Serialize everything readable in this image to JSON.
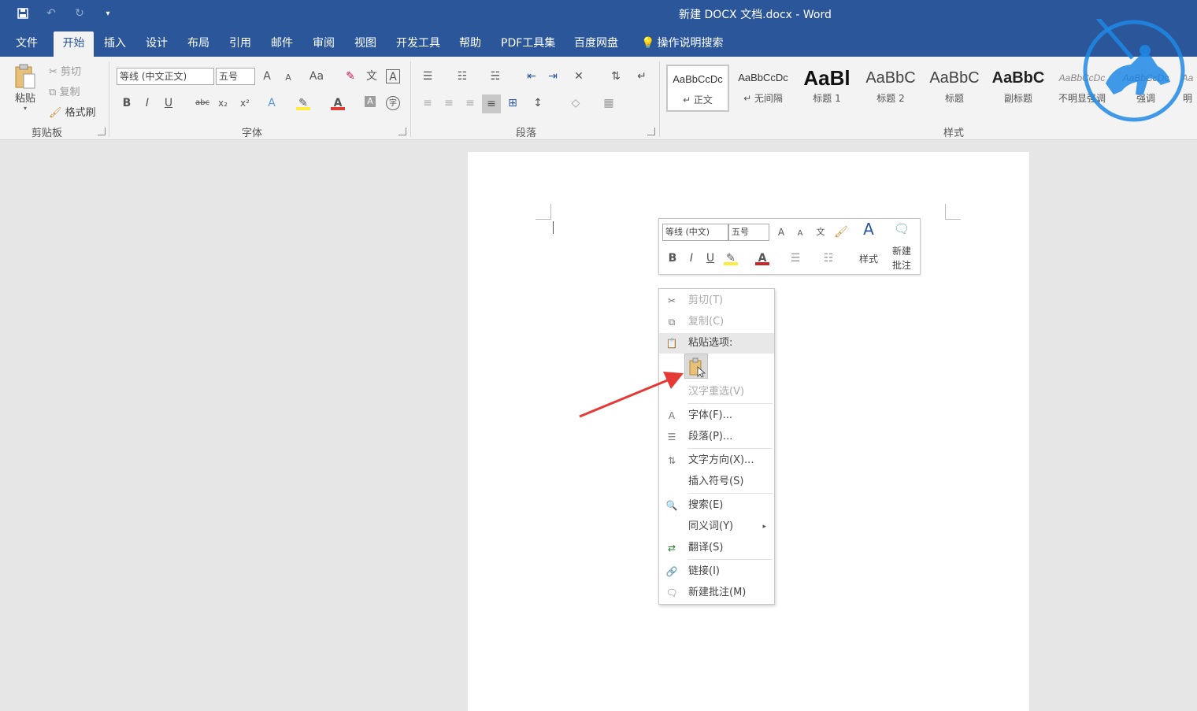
{
  "titlebar": {
    "title": "新建 DOCX 文档.docx - Word",
    "qat": [
      "save-icon",
      "undo-icon",
      "redo-icon",
      "customize-icon"
    ]
  },
  "tabs": [
    "文件",
    "开始",
    "插入",
    "设计",
    "布局",
    "引用",
    "邮件",
    "审阅",
    "视图",
    "开发工具",
    "帮助",
    "PDF工具集",
    "百度网盘",
    "操作说明搜索"
  ],
  "ribbon": {
    "clipboard": {
      "paste": "粘贴",
      "cut": "剪切",
      "copy": "复制",
      "format_painter": "格式刷",
      "label": "剪贴板"
    },
    "font": {
      "font_name": "等线 (中文正文)",
      "font_size": "五号",
      "label": "字体",
      "bold": "B",
      "italic": "I",
      "underline": "U",
      "strike": "abc",
      "sub": "x₂",
      "sup": "x²",
      "grow": "A",
      "shrink": "A",
      "case": "Aa",
      "font_color": "A",
      "char_shade": "A",
      "char_border": "A",
      "phonetic": "文"
    },
    "paragraph": {
      "label": "段落"
    },
    "styles": {
      "label": "样式",
      "items": [
        {
          "preview": "AaBbCcDc",
          "name": "↵ 正文"
        },
        {
          "preview": "AaBbCcDc",
          "name": "↵ 无间隔"
        },
        {
          "preview": "AaBl",
          "name": "标题 1"
        },
        {
          "preview": "AaBbC",
          "name": "标题 2"
        },
        {
          "preview": "AaBbC",
          "name": "标题"
        },
        {
          "preview": "AaBbC",
          "name": "副标题"
        },
        {
          "preview": "AaBbCcDc",
          "name": "不明显强调"
        },
        {
          "preview": "AaBbCcDc",
          "name": "强调"
        },
        {
          "preview": "Aa",
          "name": "明"
        }
      ]
    }
  },
  "mini_toolbar": {
    "font_name": "等线 (中文)",
    "font_size": "五号",
    "styles_label": "样式",
    "new_comment_label_1": "新建",
    "new_comment_label_2": "批注",
    "bold": "B",
    "italic": "I",
    "underline": "U",
    "font_color": "A"
  },
  "context_menu": {
    "cut": "剪切(T)",
    "copy": "复制(C)",
    "paste_options": "粘贴选项:",
    "reconvert": "汉字重选(V)",
    "font": "字体(F)...",
    "paragraph": "段落(P)...",
    "text_direction": "文字方向(X)...",
    "insert_symbol": "插入符号(S)",
    "search": "搜索(E)",
    "synonyms": "同义词(Y)",
    "translate": "翻译(S)",
    "link": "链接(I)",
    "new_comment": "新建批注(M)"
  },
  "colors": {
    "brand": "#2b579a",
    "arrow": "#e53935",
    "watermark": "#1e88e5"
  }
}
